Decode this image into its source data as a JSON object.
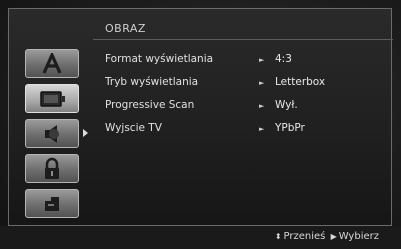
{
  "menu": {
    "title": "OBRAZ",
    "sidebar_icons": [
      "language-icon",
      "display-icon",
      "audio-icon",
      "lock-icon",
      "other-icon"
    ],
    "active_index": 1,
    "rows": [
      {
        "label": "Format wyświetlania",
        "value": "4:3"
      },
      {
        "label": "Tryb wyświetlania",
        "value": "Letterbox"
      },
      {
        "label": "Progressive Scan",
        "value": "Wył."
      },
      {
        "label": "Wyjscie TV",
        "value": "YPbPr"
      }
    ]
  },
  "footer": {
    "move_icon": "up-down-arrows-icon",
    "move_label": "Przenieś",
    "select_icon": "play-triangle-icon",
    "select_label": "Wybierz"
  }
}
